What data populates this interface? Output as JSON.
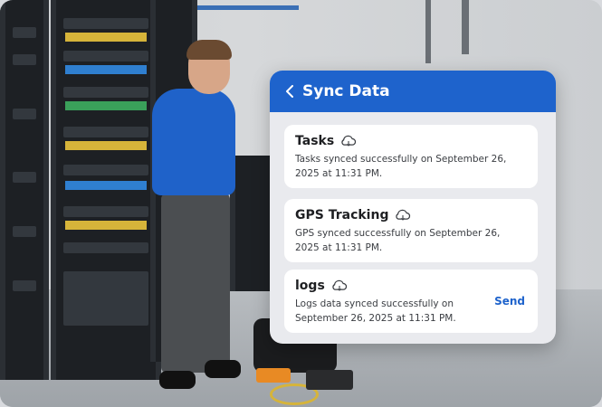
{
  "panel": {
    "title": "Sync Data",
    "cards": [
      {
        "title": "Tasks",
        "text": "Tasks synced successfully on September 26, 2025 at 11:31 PM."
      },
      {
        "title": "GPS Tracking",
        "text": "GPS synced successfully on September 26, 2025 at 11:31 PM."
      },
      {
        "title": "logs",
        "text": "Logs data synced successfully on September 26, 2025 at 11:31 PM.",
        "action": "Send"
      }
    ]
  },
  "colors": {
    "accent": "#1e63cc",
    "panel_bg": "#e9eaee",
    "card_bg": "#ffffff"
  },
  "icons": {
    "back": "chevron-left-icon",
    "cloud": "cloud-sync-icon"
  }
}
